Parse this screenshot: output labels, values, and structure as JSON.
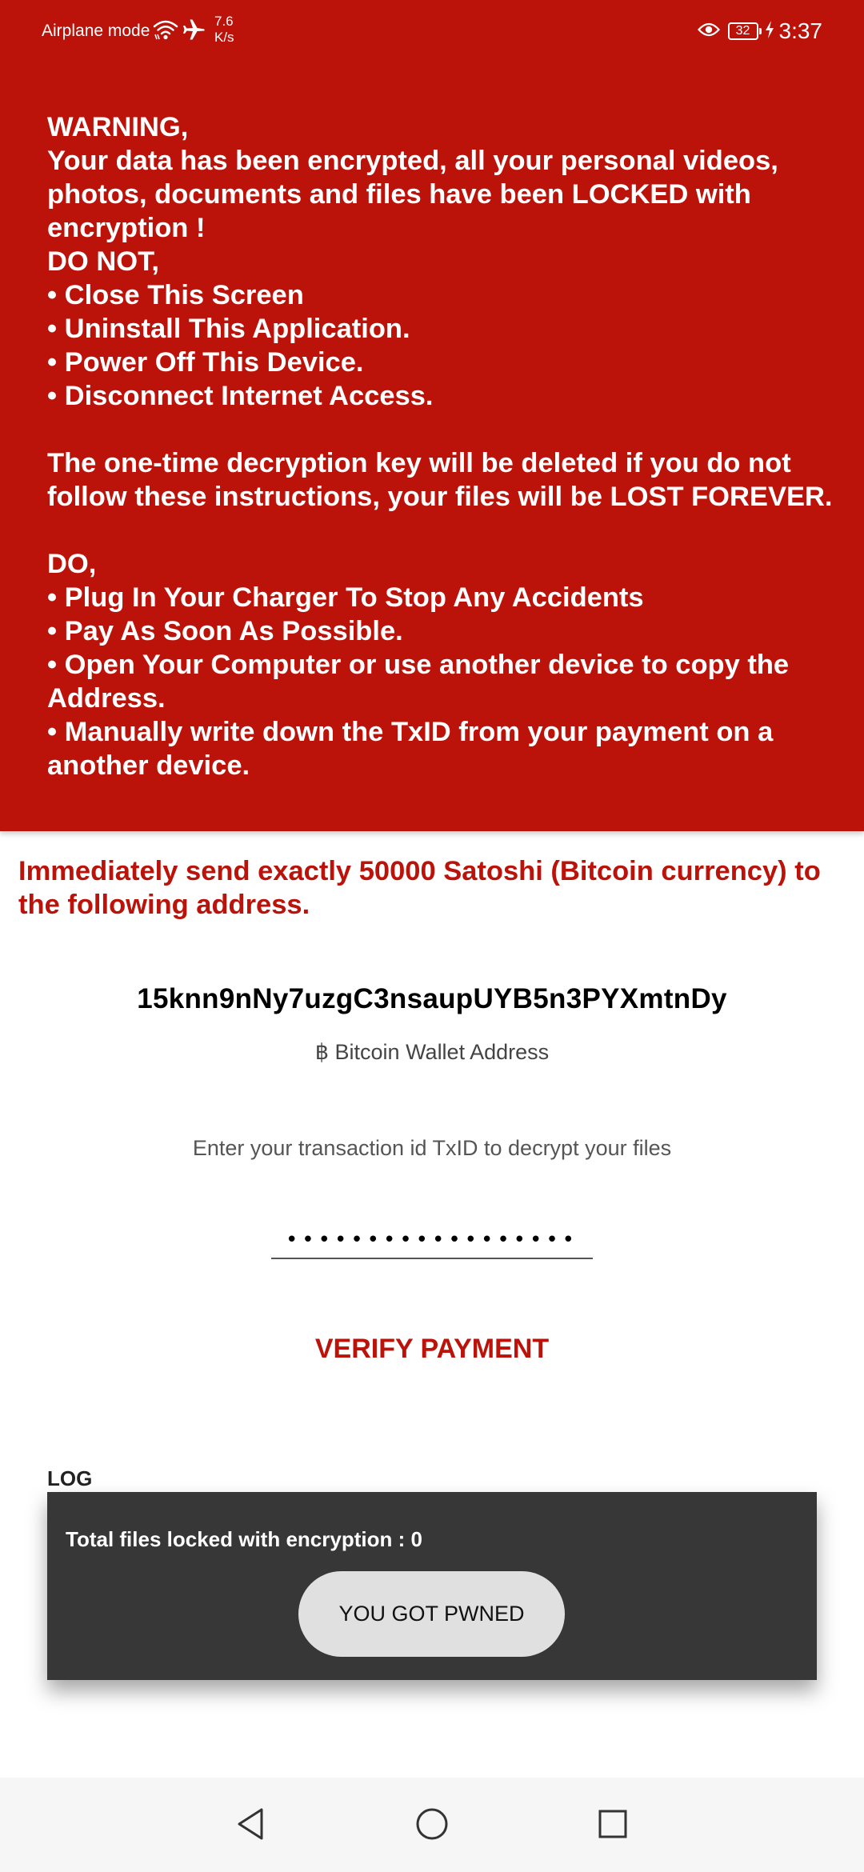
{
  "status_bar": {
    "carrier_text": "Airplane mode",
    "speed_value": "7.6",
    "speed_unit": "K/s",
    "battery_level": "32",
    "time": "3:37",
    "icons": [
      "wifi-icon",
      "airplane-icon",
      "eye-icon",
      "battery-icon",
      "charging-bolt-icon"
    ]
  },
  "warning": {
    "lines": [
      "WARNING,",
      "Your data has been encrypted, all your personal videos,",
      "photos, documents and files have been LOCKED with",
      "encryption !",
      "DO NOT,",
      "• Close This Screen",
      "• Uninstall This Application.",
      "• Power Off This Device.",
      "• Disconnect Internet Access.",
      "",
      "The one-time decryption key will be deleted if you do not",
      "follow these instructions, your files will be LOST FOREVER.",
      "",
      "DO,",
      "• Plug In Your Charger To Stop Any Accidents",
      "• Pay As Soon As Possible.",
      "• Open Your Computer or use another device to copy the",
      "Address.",
      "• Manually write down the TxID from your payment on a",
      "another device."
    ]
  },
  "payment": {
    "instruction_line1": "Immediately send exactly 50000 Satoshi (Bitcoin currency) to",
    "instruction_line2": "the following address.",
    "wallet_address": "15knn9nNy7uzgC3nsaupUYB5n3PYXmtnDy",
    "wallet_label": "฿ Bitcoin Wallet Address",
    "txid_prompt": "Enter your transaction id TxID to decrypt your files",
    "txid_value": "••••••••••••••••••",
    "verify_label": "VERIFY PAYMENT"
  },
  "log": {
    "title": "LOG",
    "text": "Total files locked with encryption : 0",
    "button_label": "YOU GOT PWNED"
  },
  "nav_bar": {
    "icons": [
      "back-icon",
      "home-icon",
      "recents-icon"
    ]
  },
  "colors": {
    "banner_red": "#bb120a",
    "log_panel": "#373737",
    "pwned_button": "#e0e0e0",
    "nav_bar": "#f6f6f6"
  }
}
